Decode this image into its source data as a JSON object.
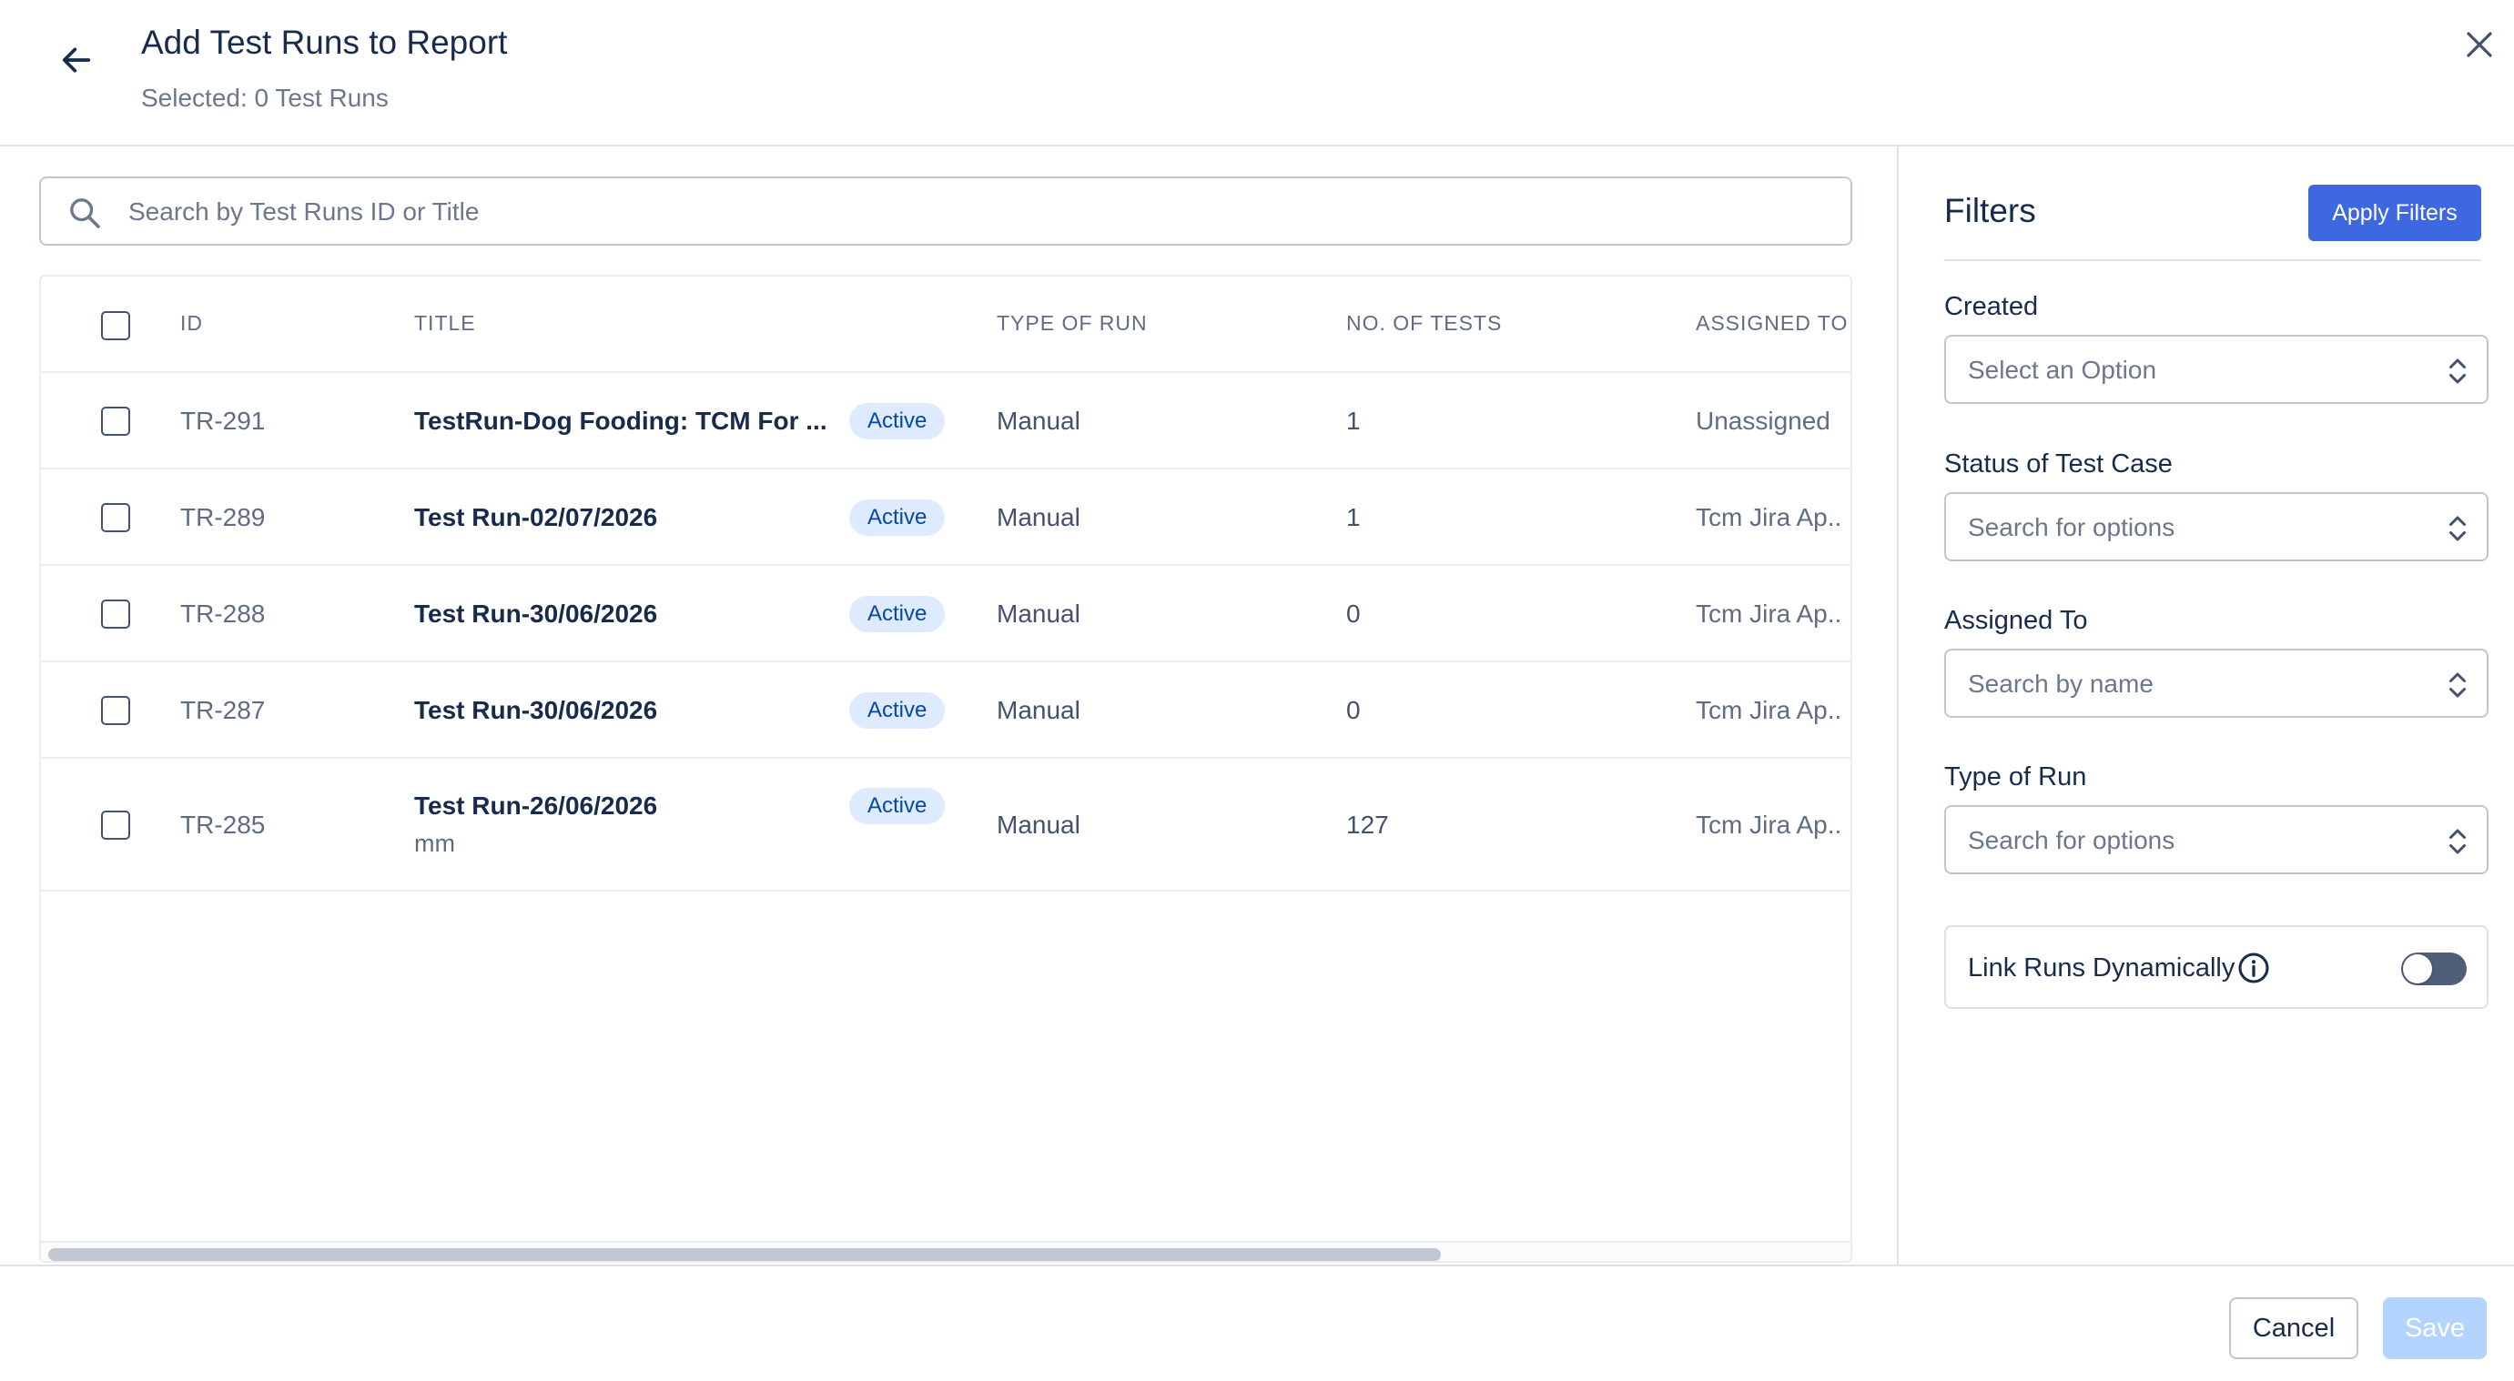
{
  "header": {
    "title": "Add Test Runs to Report",
    "subtitle": "Selected: 0 Test Runs"
  },
  "search": {
    "placeholder": "Search by Test Runs ID or Title"
  },
  "table": {
    "columns": [
      "ID",
      "TITLE",
      "TYPE OF RUN",
      "NO. OF TESTS",
      "ASSIGNED TO"
    ],
    "rows": [
      {
        "id": "TR-291",
        "title": "TestRun-Dog Fooding: TCM For ...",
        "subtitle": "",
        "status": "Active",
        "type": "Manual",
        "tests": "1",
        "assigned": "Unassigned"
      },
      {
        "id": "TR-289",
        "title": "Test Run-02/07/2026",
        "subtitle": "",
        "status": "Active",
        "type": "Manual",
        "tests": "1",
        "assigned": "Tcm Jira Ap.."
      },
      {
        "id": "TR-288",
        "title": "Test Run-30/06/2026",
        "subtitle": "",
        "status": "Active",
        "type": "Manual",
        "tests": "0",
        "assigned": "Tcm Jira Ap.."
      },
      {
        "id": "TR-287",
        "title": "Test Run-30/06/2026",
        "subtitle": "",
        "status": "Active",
        "type": "Manual",
        "tests": "0",
        "assigned": "Tcm Jira Ap.."
      },
      {
        "id": "TR-285",
        "title": "Test Run-26/06/2026",
        "subtitle": "mm",
        "status": "Active",
        "type": "Manual",
        "tests": "127",
        "assigned": "Tcm Jira Ap.."
      }
    ]
  },
  "filters": {
    "title": "Filters",
    "apply_label": "Apply Filters",
    "created": {
      "label": "Created",
      "placeholder": "Select an Option"
    },
    "status": {
      "label": "Status of Test Case",
      "placeholder": "Search for options"
    },
    "assigned": {
      "label": "Assigned To",
      "placeholder": "Search by name"
    },
    "type_of_run": {
      "label": "Type of Run",
      "placeholder": "Search for options"
    },
    "link_runs": {
      "label": "Link Runs Dynamically"
    }
  },
  "footer": {
    "cancel_label": "Cancel",
    "save_label": "Save"
  },
  "colors": {
    "primary": "#3d68e0",
    "badge_bg": "#deebff",
    "badge_text": "#0747a6",
    "save_disabled": "#b3d4ff"
  }
}
